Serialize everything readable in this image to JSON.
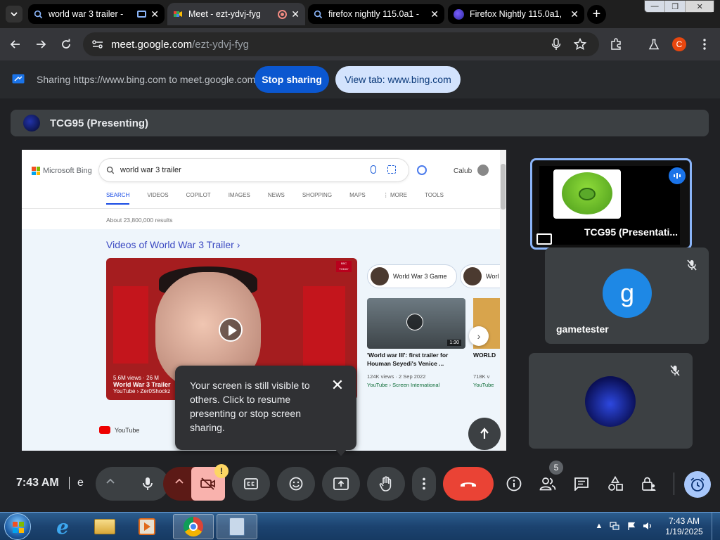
{
  "tabs": [
    {
      "title": "world war 3 trailer -",
      "active": false
    },
    {
      "title": "Meet - ezt-ydvj-fyg",
      "active": true
    },
    {
      "title": "firefox nightly 115.0a1 -",
      "active": false
    },
    {
      "title": "Firefox Nightly 115.0a1,",
      "active": false
    }
  ],
  "tab_close": "✕",
  "new_tab": "+",
  "window_controls": {
    "minimize": "—",
    "restore": "❐",
    "close": "✕"
  },
  "address": {
    "domain": "meet.google.com",
    "path": "/ezt-ydvj-fyg"
  },
  "profile_initial": "C",
  "sharing": {
    "text": "Sharing https://www.bing.com to meet.google.com",
    "stop_label": "Stop sharing",
    "view_label": "View tab: www.bing.com"
  },
  "presenter": {
    "label": "TCG95 (Presenting)"
  },
  "shared_page": {
    "brand": "Microsoft Bing",
    "query": "world war 3 trailer",
    "user": "Calub",
    "tabs": [
      "SEARCH",
      "VIDEOS",
      "COPILOT",
      "IMAGES",
      "NEWS",
      "SHOPPING",
      "MAPS",
      "⋮ MORE",
      "TOOLS"
    ],
    "results_count": "About 23,800,000 results",
    "videos_heading": "Videos of World War 3 Trailer ›",
    "main_video": {
      "views": "5.6M views",
      "time": "26 M",
      "title": "World War 3 Trailer",
      "source": "YouTube › Zer0Shockz",
      "logo": "BBC TODAY"
    },
    "chip1": "World War 3 Game",
    "chip2": "Worl",
    "side_video": {
      "duration": "1:30",
      "title": "'World war III': first trailer for Houman Seyedi's Venice ...",
      "meta": "124K views · 2 Sep 2022",
      "source": "YouTube › Screen International"
    },
    "side_video2": {
      "title": "WORLD",
      "meta": "718K v",
      "source": "YouTube"
    },
    "youtube_row": "YouTube"
  },
  "tooltip": {
    "text": "Your screen is still visible to others. Click to resume presenting or stop screen sharing.",
    "close": "✕"
  },
  "participants": [
    {
      "name": "TCG95 (Presentati...",
      "speaking": true
    },
    {
      "name": "gametester",
      "initial": "g",
      "muted": true
    },
    {
      "name": "",
      "muted": true
    }
  ],
  "controls": {
    "time": "7:43 AM",
    "meeting_code_partial": "e",
    "camera_warning": "!",
    "people_count": "5"
  },
  "taskbar": {
    "time": "7:43 AM",
    "date": "1/19/2025"
  },
  "colors": {
    "meet_bg": "#202124",
    "accent_blue": "#0b57d0",
    "end_call_red": "#ea4335",
    "speaking_outline": "#8ab4f8"
  }
}
